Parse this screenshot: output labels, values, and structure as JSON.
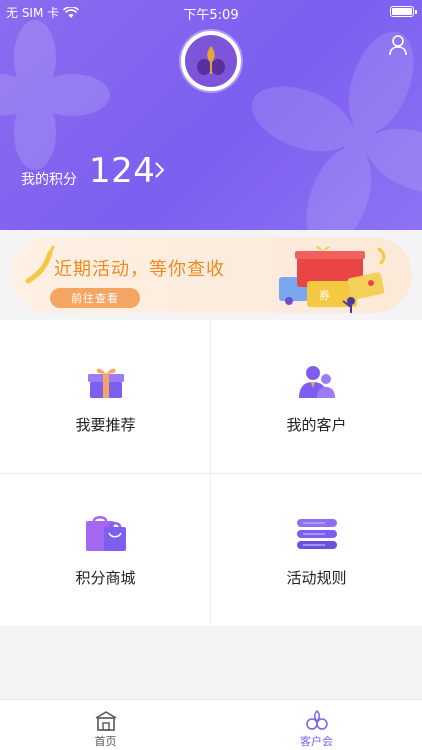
{
  "status_bar": {
    "carrier": "无 SIM 卡",
    "time": "下午5:09"
  },
  "header": {
    "points_label": "我的积分",
    "points_value": "124"
  },
  "banner": {
    "title": "近期活动，等你查收",
    "button_label": "前往查看",
    "ticket_text": "券"
  },
  "grid": [
    {
      "label": "我要推荐",
      "icon": "gift-icon"
    },
    {
      "label": "我的客户",
      "icon": "customers-icon"
    },
    {
      "label": "积分商城",
      "icon": "shopping-bag-icon"
    },
    {
      "label": "活动规则",
      "icon": "rules-stack-icon"
    }
  ],
  "tabbar": [
    {
      "label": "首页",
      "icon": "home-icon",
      "active": false
    },
    {
      "label": "客户会",
      "icon": "club-icon",
      "active": true
    }
  ],
  "colors": {
    "primary": "#7d5ff0",
    "accent_orange": "#f08a1f",
    "tab_active": "#7d5ff0",
    "tab_inactive": "#555555"
  }
}
